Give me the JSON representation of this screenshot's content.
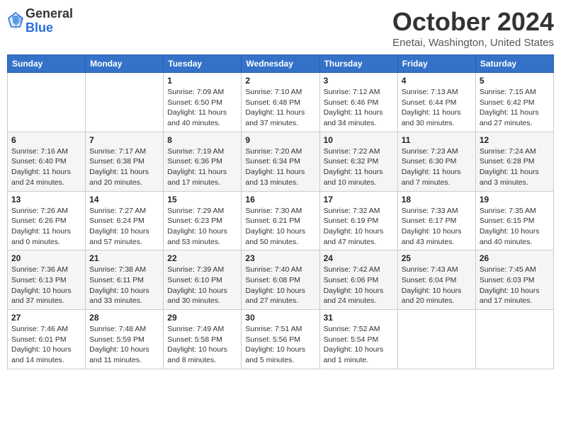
{
  "logo": {
    "general": "General",
    "blue": "Blue"
  },
  "header": {
    "month": "October 2024",
    "location": "Enetai, Washington, United States"
  },
  "days_of_week": [
    "Sunday",
    "Monday",
    "Tuesday",
    "Wednesday",
    "Thursday",
    "Friday",
    "Saturday"
  ],
  "weeks": [
    [
      {
        "day": "",
        "info": ""
      },
      {
        "day": "",
        "info": ""
      },
      {
        "day": "1",
        "info": "Sunrise: 7:09 AM\nSunset: 6:50 PM\nDaylight: 11 hours and 40 minutes."
      },
      {
        "day": "2",
        "info": "Sunrise: 7:10 AM\nSunset: 6:48 PM\nDaylight: 11 hours and 37 minutes."
      },
      {
        "day": "3",
        "info": "Sunrise: 7:12 AM\nSunset: 6:46 PM\nDaylight: 11 hours and 34 minutes."
      },
      {
        "day": "4",
        "info": "Sunrise: 7:13 AM\nSunset: 6:44 PM\nDaylight: 11 hours and 30 minutes."
      },
      {
        "day": "5",
        "info": "Sunrise: 7:15 AM\nSunset: 6:42 PM\nDaylight: 11 hours and 27 minutes."
      }
    ],
    [
      {
        "day": "6",
        "info": "Sunrise: 7:16 AM\nSunset: 6:40 PM\nDaylight: 11 hours and 24 minutes."
      },
      {
        "day": "7",
        "info": "Sunrise: 7:17 AM\nSunset: 6:38 PM\nDaylight: 11 hours and 20 minutes."
      },
      {
        "day": "8",
        "info": "Sunrise: 7:19 AM\nSunset: 6:36 PM\nDaylight: 11 hours and 17 minutes."
      },
      {
        "day": "9",
        "info": "Sunrise: 7:20 AM\nSunset: 6:34 PM\nDaylight: 11 hours and 13 minutes."
      },
      {
        "day": "10",
        "info": "Sunrise: 7:22 AM\nSunset: 6:32 PM\nDaylight: 11 hours and 10 minutes."
      },
      {
        "day": "11",
        "info": "Sunrise: 7:23 AM\nSunset: 6:30 PM\nDaylight: 11 hours and 7 minutes."
      },
      {
        "day": "12",
        "info": "Sunrise: 7:24 AM\nSunset: 6:28 PM\nDaylight: 11 hours and 3 minutes."
      }
    ],
    [
      {
        "day": "13",
        "info": "Sunrise: 7:26 AM\nSunset: 6:26 PM\nDaylight: 11 hours and 0 minutes."
      },
      {
        "day": "14",
        "info": "Sunrise: 7:27 AM\nSunset: 6:24 PM\nDaylight: 10 hours and 57 minutes."
      },
      {
        "day": "15",
        "info": "Sunrise: 7:29 AM\nSunset: 6:23 PM\nDaylight: 10 hours and 53 minutes."
      },
      {
        "day": "16",
        "info": "Sunrise: 7:30 AM\nSunset: 6:21 PM\nDaylight: 10 hours and 50 minutes."
      },
      {
        "day": "17",
        "info": "Sunrise: 7:32 AM\nSunset: 6:19 PM\nDaylight: 10 hours and 47 minutes."
      },
      {
        "day": "18",
        "info": "Sunrise: 7:33 AM\nSunset: 6:17 PM\nDaylight: 10 hours and 43 minutes."
      },
      {
        "day": "19",
        "info": "Sunrise: 7:35 AM\nSunset: 6:15 PM\nDaylight: 10 hours and 40 minutes."
      }
    ],
    [
      {
        "day": "20",
        "info": "Sunrise: 7:36 AM\nSunset: 6:13 PM\nDaylight: 10 hours and 37 minutes."
      },
      {
        "day": "21",
        "info": "Sunrise: 7:38 AM\nSunset: 6:11 PM\nDaylight: 10 hours and 33 minutes."
      },
      {
        "day": "22",
        "info": "Sunrise: 7:39 AM\nSunset: 6:10 PM\nDaylight: 10 hours and 30 minutes."
      },
      {
        "day": "23",
        "info": "Sunrise: 7:40 AM\nSunset: 6:08 PM\nDaylight: 10 hours and 27 minutes."
      },
      {
        "day": "24",
        "info": "Sunrise: 7:42 AM\nSunset: 6:06 PM\nDaylight: 10 hours and 24 minutes."
      },
      {
        "day": "25",
        "info": "Sunrise: 7:43 AM\nSunset: 6:04 PM\nDaylight: 10 hours and 20 minutes."
      },
      {
        "day": "26",
        "info": "Sunrise: 7:45 AM\nSunset: 6:03 PM\nDaylight: 10 hours and 17 minutes."
      }
    ],
    [
      {
        "day": "27",
        "info": "Sunrise: 7:46 AM\nSunset: 6:01 PM\nDaylight: 10 hours and 14 minutes."
      },
      {
        "day": "28",
        "info": "Sunrise: 7:48 AM\nSunset: 5:59 PM\nDaylight: 10 hours and 11 minutes."
      },
      {
        "day": "29",
        "info": "Sunrise: 7:49 AM\nSunset: 5:58 PM\nDaylight: 10 hours and 8 minutes."
      },
      {
        "day": "30",
        "info": "Sunrise: 7:51 AM\nSunset: 5:56 PM\nDaylight: 10 hours and 5 minutes."
      },
      {
        "day": "31",
        "info": "Sunrise: 7:52 AM\nSunset: 5:54 PM\nDaylight: 10 hours and 1 minute."
      },
      {
        "day": "",
        "info": ""
      },
      {
        "day": "",
        "info": ""
      }
    ]
  ]
}
